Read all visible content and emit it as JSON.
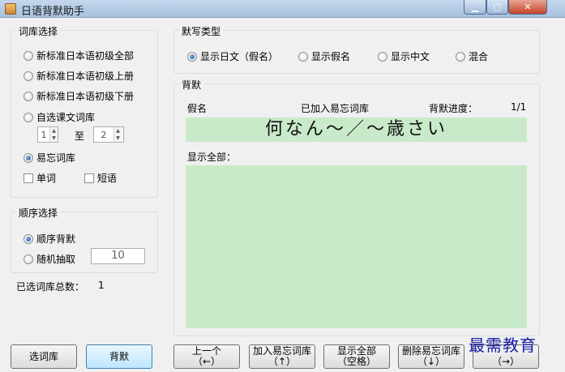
{
  "window": {
    "title": "日语背默助手"
  },
  "lexicon": {
    "legend": "词库选择",
    "options": [
      "新标准日本语初级全部",
      "新标准日本语初级上册",
      "新标准日本语初级下册",
      "自选课文词库",
      "易忘词库"
    ],
    "range_from": "1",
    "range_to_label": "至",
    "range_to": "2",
    "word_label": "单词",
    "phrase_label": "短语"
  },
  "order": {
    "legend": "顺序选择",
    "sequential_label": "顺序背默",
    "random_label": "随机抽取",
    "random_count": "10"
  },
  "total": {
    "label": "已选词库总数：",
    "value": "1"
  },
  "dictation": {
    "legend": "默写类型",
    "options": [
      "显示日文（假名）",
      "显示假名",
      "显示中文",
      "混合"
    ]
  },
  "recite": {
    "legend": "背默",
    "kana_label": "假名",
    "added_label": "已加入易忘词库",
    "progress_label": "背默进度：",
    "progress_value": "1/1",
    "word": "何なん～／～歳さい",
    "show_all_label": "显示全部："
  },
  "buttons": {
    "select_lexicon": "选词库",
    "recite": "背默",
    "prev": "上一个",
    "prev_key": "（←）",
    "add_forget": "加入易忘词库",
    "add_forget_key": "（↑）",
    "show_all": "显示全部",
    "show_all_key": "（空格）",
    "delete_forget": "删除易忘词库",
    "delete_forget_key": "（↓）",
    "next_key": "（→）"
  },
  "watermark": "最需教育",
  "colors": {
    "answer_bg": "#c9eac9",
    "titlebar": "#b8cfe9"
  }
}
